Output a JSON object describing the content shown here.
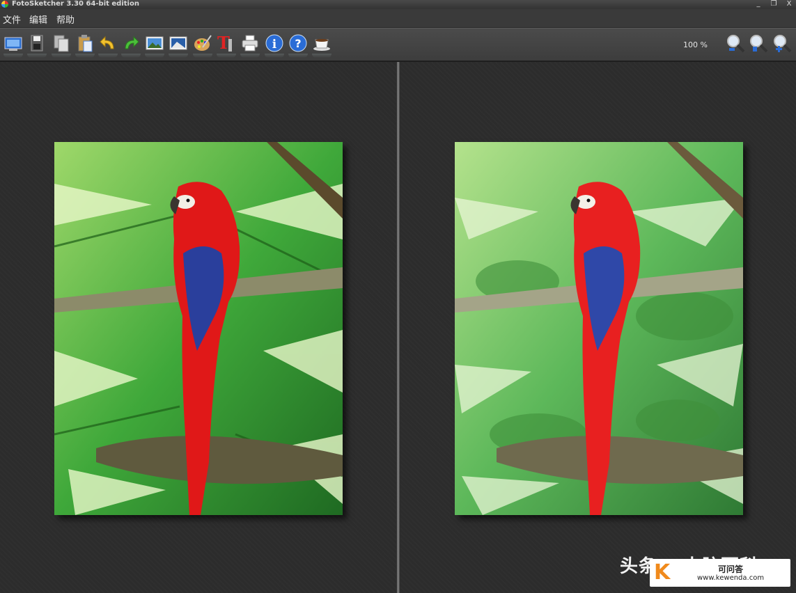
{
  "window": {
    "title": "FotoSketcher 3.30 64-bit edition",
    "minimize": "_",
    "restore": "❐",
    "close": "X"
  },
  "menu": {
    "file": "文件",
    "edit": "编辑",
    "help": "帮助"
  },
  "toolbar": {
    "buttons": [
      "open-image",
      "save",
      "copy",
      "paste",
      "undo",
      "redo",
      "process-image",
      "compare-image",
      "paint",
      "text",
      "print",
      "info",
      "help",
      "coffee"
    ],
    "zoom_label": "100 %",
    "zoom_buttons": [
      "zoom-out",
      "zoom-fit",
      "zoom-in"
    ]
  },
  "panes": {
    "left": {
      "content": "original parrot photo"
    },
    "right": {
      "content": "painted parrot result"
    }
  },
  "watermark": {
    "text": "头条 @电脑百科",
    "site_cn": "可问答",
    "site_url": "www.kewenda.com",
    "logo_letter": "K"
  },
  "colors": {
    "background": "#2b2b2b",
    "parrot_red": "#e01818",
    "foliage": "#3fa83a"
  }
}
